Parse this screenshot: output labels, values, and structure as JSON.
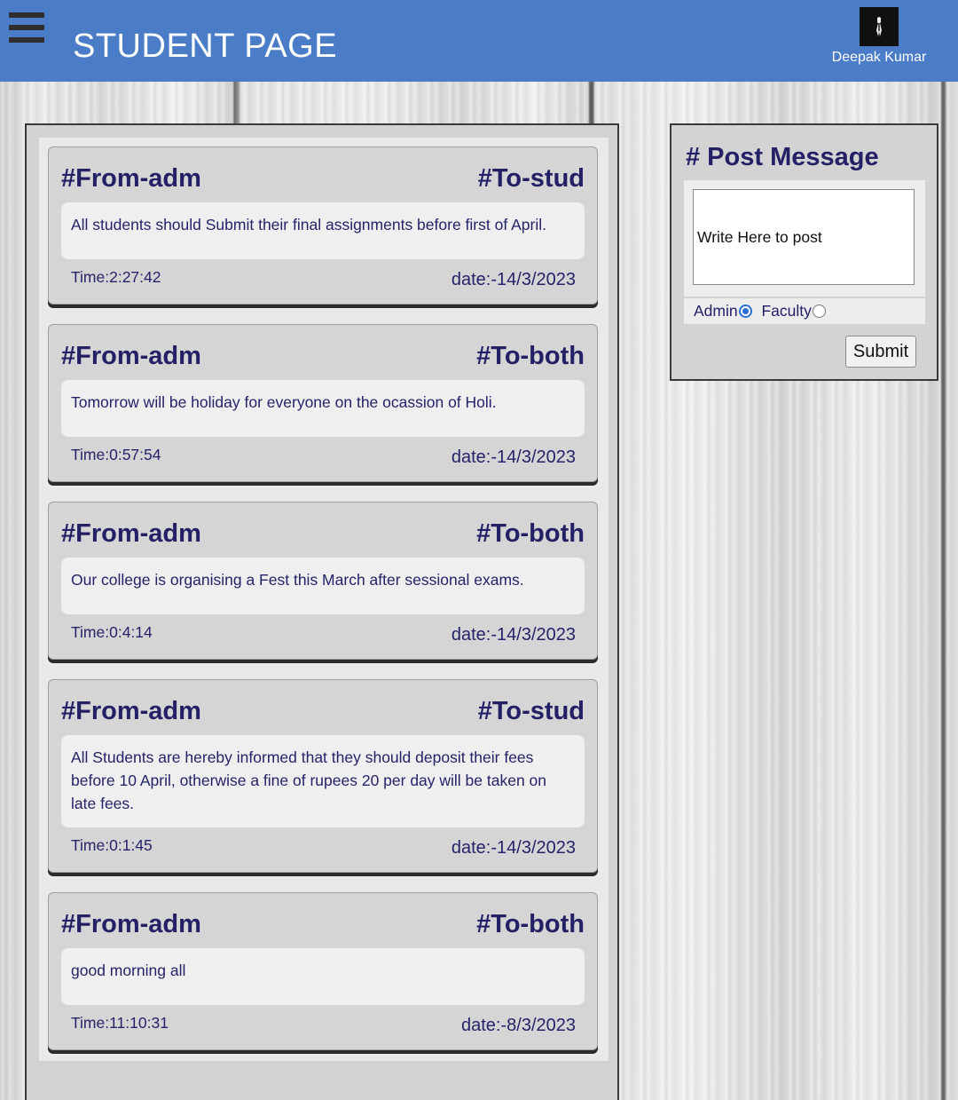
{
  "header": {
    "title": "STUDENT PAGE",
    "menu_icon": "hamburger-menu-icon",
    "user_name": "Deepak Kumar",
    "bg_color": "#4a7cc7"
  },
  "posts": [
    {
      "from": "#From-adm",
      "to": "#To-stud",
      "message": "All students should Submit their final assignments before first of April.",
      "time": "Time:2:27:42",
      "date": "date:-14/3/2023"
    },
    {
      "from": "#From-adm",
      "to": "#To-both",
      "message": "Tomorrow will be holiday for everyone on the ocassion of Holi.",
      "time": "Time:0:57:54",
      "date": "date:-14/3/2023"
    },
    {
      "from": "#From-adm",
      "to": "#To-both",
      "message": "Our college is organising a Fest this March after sessional exams.",
      "time": "Time:0:4:14",
      "date": "date:-14/3/2023"
    },
    {
      "from": "#From-adm",
      "to": "#To-stud",
      "message": "All Students are hereby informed that they should deposit their fees before 10 April, otherwise a fine of rupees 20 per day will be taken on late fees.",
      "time": "Time:0:1:45",
      "date": "date:-14/3/2023"
    },
    {
      "from": "#From-adm",
      "to": "#To-both",
      "message": "good morning all",
      "time": "Time:11:10:31",
      "date": "date:-8/3/2023"
    }
  ],
  "compose": {
    "title": "# Post Message",
    "placeholder": "Write Here to post",
    "recipient_options": [
      "Admin",
      "Faculty"
    ],
    "selected_recipient": "Admin",
    "submit_label": "Submit"
  },
  "colors": {
    "text_primary": "#232066",
    "accent_radio": "#2a6fd6"
  }
}
